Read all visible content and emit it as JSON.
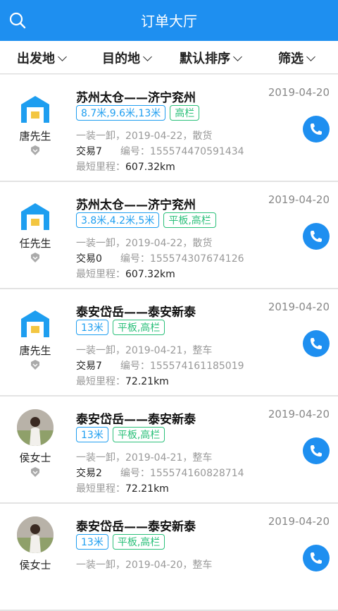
{
  "header": {
    "title": "订单大厅",
    "search_icon": "search-icon"
  },
  "filters": [
    {
      "label": "出发地",
      "icon": "chevron-down-icon"
    },
    {
      "label": "目的地",
      "icon": "chevron-down-icon"
    },
    {
      "label": "默认排序",
      "icon": "chevron-down-icon"
    },
    {
      "label": "筛选",
      "icon": "chevron-down-icon"
    }
  ],
  "orders": [
    {
      "avatar": "warehouse-icon",
      "name": "唐先生",
      "route": "苏州太仓——济宁兖州",
      "date": "2019-04-20",
      "tags": [
        {
          "text": "8.7米,9.6米,13米",
          "color": "blue"
        },
        {
          "text": "高栏",
          "color": "green"
        }
      ],
      "detail": "一装一卸，2019-04-22，散货",
      "trade": "交易7",
      "number_label": "编号：",
      "number": "155574470591434",
      "dist_label": "最短里程：",
      "dist": "607.32km"
    },
    {
      "avatar": "warehouse-icon",
      "name": "任先生",
      "route": "苏州太仓——济宁兖州",
      "date": "2019-04-20",
      "tags": [
        {
          "text": "3.8米,4.2米,5米",
          "color": "blue"
        },
        {
          "text": "平板,高栏",
          "color": "green"
        }
      ],
      "detail": "一装一卸，2019-04-22，散货",
      "trade": "交易0",
      "number_label": "编号：",
      "number": "155574307674126",
      "dist_label": "最短里程：",
      "dist": "607.32km"
    },
    {
      "avatar": "warehouse-icon",
      "name": "唐先生",
      "route": "泰安岱岳——泰安新泰",
      "date": "2019-04-20",
      "tags": [
        {
          "text": "13米",
          "color": "blue"
        },
        {
          "text": "平板,高栏",
          "color": "green"
        }
      ],
      "detail": "一装一卸，2019-04-21，整车",
      "trade": "交易7",
      "number_label": "编号：",
      "number": "155574161185019",
      "dist_label": "最短里程：",
      "dist": "72.21km"
    },
    {
      "avatar": "user-photo",
      "name": "侯女士",
      "route": "泰安岱岳——泰安新泰",
      "date": "2019-04-20",
      "tags": [
        {
          "text": "13米",
          "color": "blue"
        },
        {
          "text": "平板,高栏",
          "color": "green"
        }
      ],
      "detail": "一装一卸，2019-04-21，整车",
      "trade": "交易2",
      "number_label": "编号：",
      "number": "155574160828714",
      "dist_label": "最短里程：",
      "dist": "72.21km"
    },
    {
      "avatar": "user-photo",
      "name": "侯女士",
      "route": "泰安岱岳——泰安新泰",
      "date": "2019-04-20",
      "tags": [
        {
          "text": "13米",
          "color": "blue"
        },
        {
          "text": "平板,高栏",
          "color": "green"
        }
      ],
      "detail": "一装一卸，2019-04-20，整车",
      "trade": "",
      "number_label": "",
      "number": "",
      "dist_label": "",
      "dist": ""
    }
  ],
  "colors": {
    "accent": "#1e8ff0",
    "tag_blue": "#1e9ef0",
    "tag_green": "#2bc07a"
  }
}
